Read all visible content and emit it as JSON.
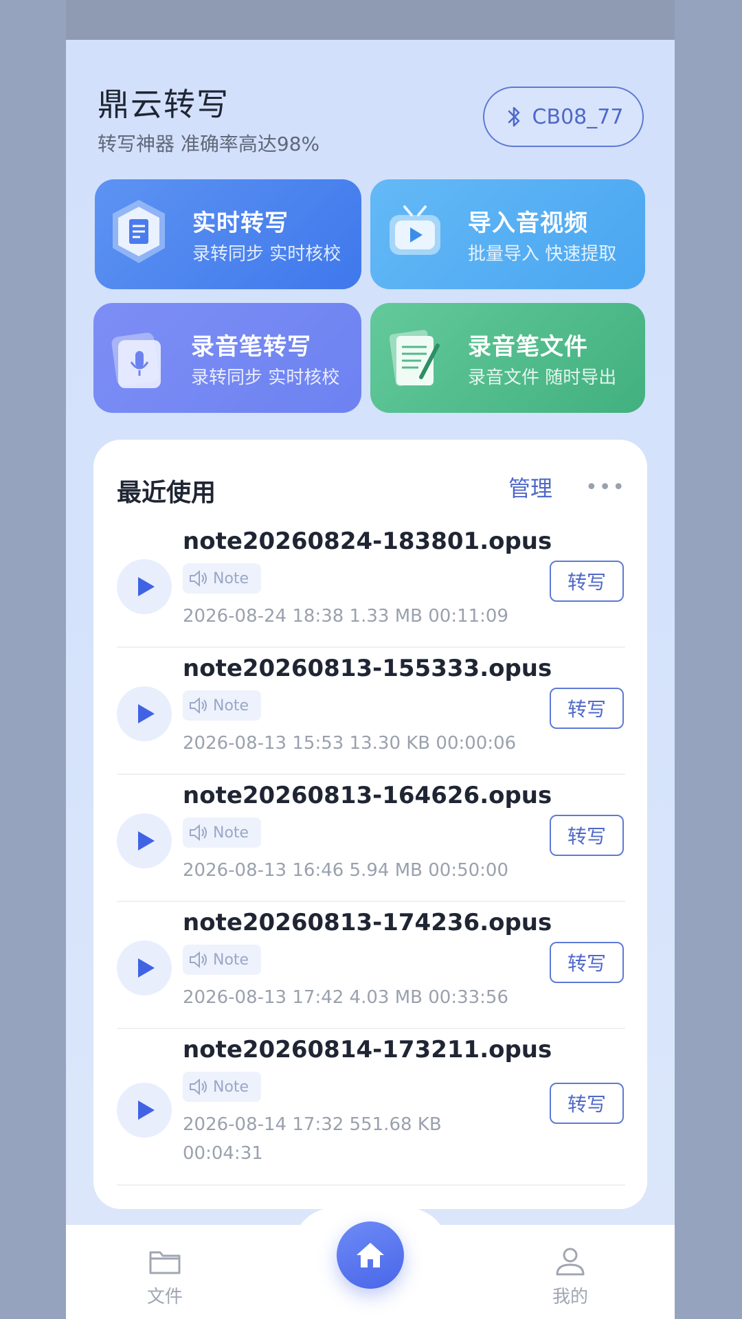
{
  "header": {
    "title": "鼎云转写",
    "subtitle": "转写神器 准确率高达98%",
    "device_label": "CB08_77"
  },
  "tiles": [
    {
      "title": "实时转写",
      "subtitle": "录转同步 实时核校",
      "icon": "document-edit-icon"
    },
    {
      "title": "导入音视频",
      "subtitle": "批量导入 快速提取",
      "icon": "video-play-icon"
    },
    {
      "title": "录音笔转写",
      "subtitle": "录转同步 实时核校",
      "icon": "microphone-folder-icon"
    },
    {
      "title": "录音笔文件",
      "subtitle": "录音文件 随时导出",
      "icon": "file-pen-icon"
    }
  ],
  "recent": {
    "title": "最近使用",
    "manage_label": "管理",
    "more_label": "•••",
    "convert_label": "转写",
    "tag_label": "Note",
    "items": [
      {
        "name": "note20260824-183801.opus",
        "meta": "2026-08-24 18:38    1.33 MB    00:11:09"
      },
      {
        "name": "note20260813-155333.opus",
        "meta": "2026-08-13 15:53    13.30 KB    00:00:06"
      },
      {
        "name": "note20260813-164626.opus",
        "meta": "2026-08-13 16:46    5.94 MB    00:50:00"
      },
      {
        "name": "note20260813-174236.opus",
        "meta": "2026-08-13 17:42    4.03 MB    00:33:56"
      },
      {
        "name": "note20260814-173211.opus",
        "meta": "2026-08-14 17:32    551.68 KB    00:04:31"
      }
    ]
  },
  "nav": {
    "files_label": "文件",
    "mine_label": "我的"
  },
  "colors": {
    "accent": "#4f68c9",
    "play": "#3f63e3",
    "background": "#d2e0fb"
  }
}
